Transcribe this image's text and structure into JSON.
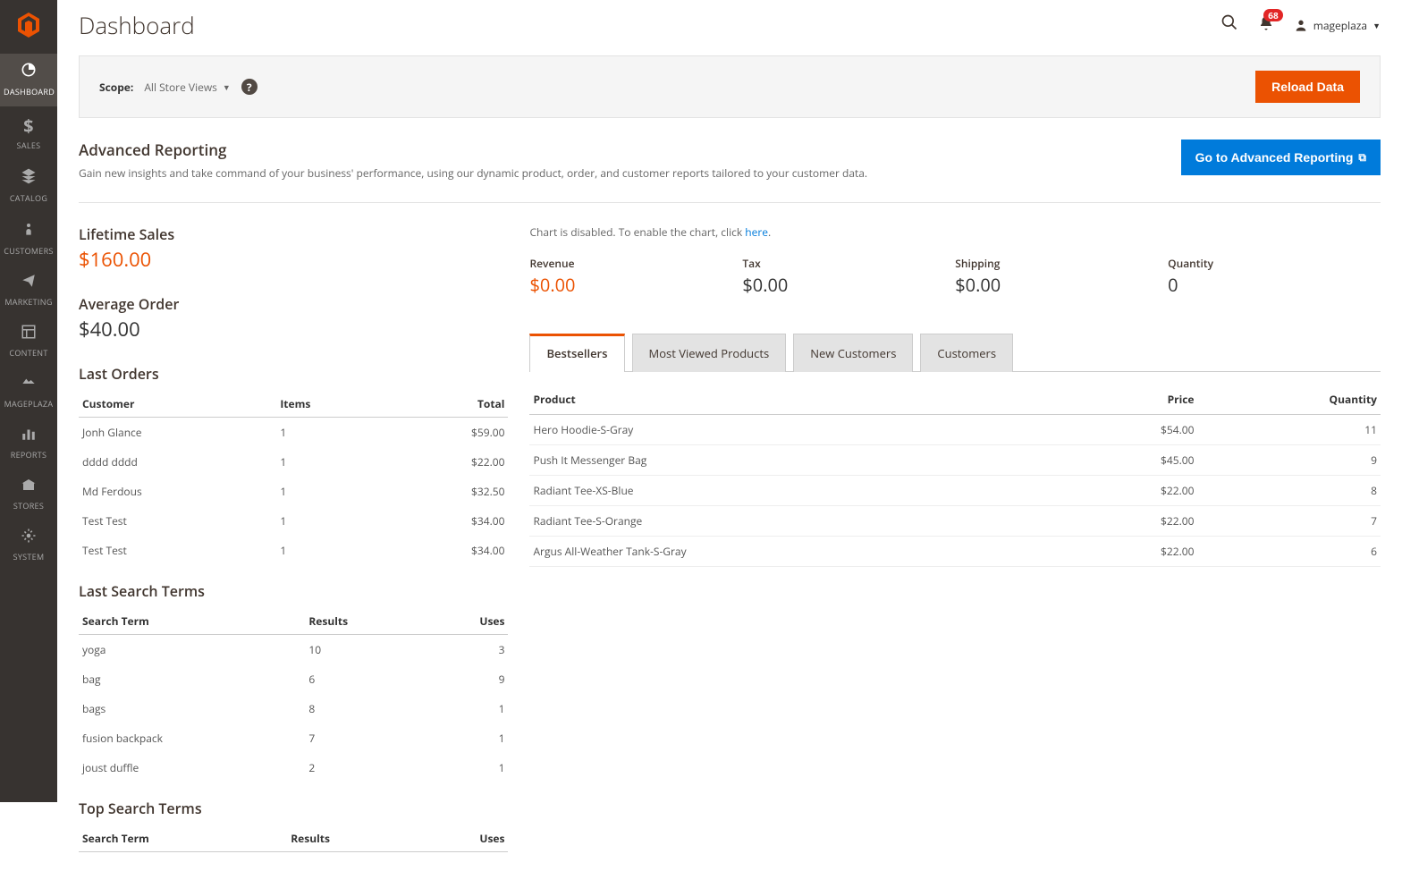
{
  "page_title": "Dashboard",
  "header": {
    "notif_count": "68",
    "username": "mageplaza"
  },
  "sidebar": {
    "items": [
      {
        "label": "DASHBOARD",
        "active": true
      },
      {
        "label": "SALES"
      },
      {
        "label": "CATALOG"
      },
      {
        "label": "CUSTOMERS"
      },
      {
        "label": "MARKETING"
      },
      {
        "label": "CONTENT"
      },
      {
        "label": "MAGEPLAZA"
      },
      {
        "label": "REPORTS"
      },
      {
        "label": "STORES"
      },
      {
        "label": "SYSTEM"
      }
    ]
  },
  "scope": {
    "label": "Scope:",
    "value": "All Store Views",
    "reload_label": "Reload Data"
  },
  "adv_report": {
    "title": "Advanced Reporting",
    "desc": "Gain new insights and take command of your business' performance, using our dynamic product, order, and customer reports tailored to your customer data.",
    "btn": "Go to Advanced Reporting"
  },
  "stats": {
    "lifetime_label": "Lifetime Sales",
    "lifetime_value": "$160.00",
    "avg_label": "Average Order",
    "avg_value": "$40.00"
  },
  "last_orders": {
    "title": "Last Orders",
    "cols": {
      "customer": "Customer",
      "items": "Items",
      "total": "Total"
    },
    "rows": [
      {
        "customer": "Jonh Glance",
        "items": "1",
        "total": "$59.00"
      },
      {
        "customer": "dddd dddd",
        "items": "1",
        "total": "$22.00"
      },
      {
        "customer": "Md Ferdous",
        "items": "1",
        "total": "$32.50"
      },
      {
        "customer": "Test Test",
        "items": "1",
        "total": "$34.00"
      },
      {
        "customer": "Test Test",
        "items": "1",
        "total": "$34.00"
      }
    ]
  },
  "last_search": {
    "title": "Last Search Terms",
    "cols": {
      "term": "Search Term",
      "results": "Results",
      "uses": "Uses"
    },
    "rows": [
      {
        "term": "yoga",
        "results": "10",
        "uses": "3"
      },
      {
        "term": "bag",
        "results": "6",
        "uses": "9"
      },
      {
        "term": "bags",
        "results": "8",
        "uses": "1"
      },
      {
        "term": "fusion backpack",
        "results": "7",
        "uses": "1"
      },
      {
        "term": "joust duffle",
        "results": "2",
        "uses": "1"
      }
    ]
  },
  "top_search": {
    "title": "Top Search Terms",
    "cols": {
      "term": "Search Term",
      "results": "Results",
      "uses": "Uses"
    }
  },
  "chart_note": {
    "text": "Chart is disabled. To enable the chart, click ",
    "link": "here",
    "suffix": "."
  },
  "metrics": {
    "revenue_label": "Revenue",
    "revenue_value": "$0.00",
    "tax_label": "Tax",
    "tax_value": "$0.00",
    "shipping_label": "Shipping",
    "shipping_value": "$0.00",
    "quantity_label": "Quantity",
    "quantity_value": "0"
  },
  "tabs": {
    "bestsellers": "Bestsellers",
    "most_viewed": "Most Viewed Products",
    "new_customers": "New Customers",
    "customers": "Customers"
  },
  "bestsellers": {
    "cols": {
      "product": "Product",
      "price": "Price",
      "quantity": "Quantity"
    },
    "rows": [
      {
        "product": "Hero Hoodie-S-Gray",
        "price": "$54.00",
        "quantity": "11"
      },
      {
        "product": "Push It Messenger Bag",
        "price": "$45.00",
        "quantity": "9"
      },
      {
        "product": "Radiant Tee-XS-Blue",
        "price": "$22.00",
        "quantity": "8"
      },
      {
        "product": "Radiant Tee-S-Orange",
        "price": "$22.00",
        "quantity": "7"
      },
      {
        "product": "Argus All-Weather Tank-S-Gray",
        "price": "$22.00",
        "quantity": "6"
      }
    ]
  }
}
